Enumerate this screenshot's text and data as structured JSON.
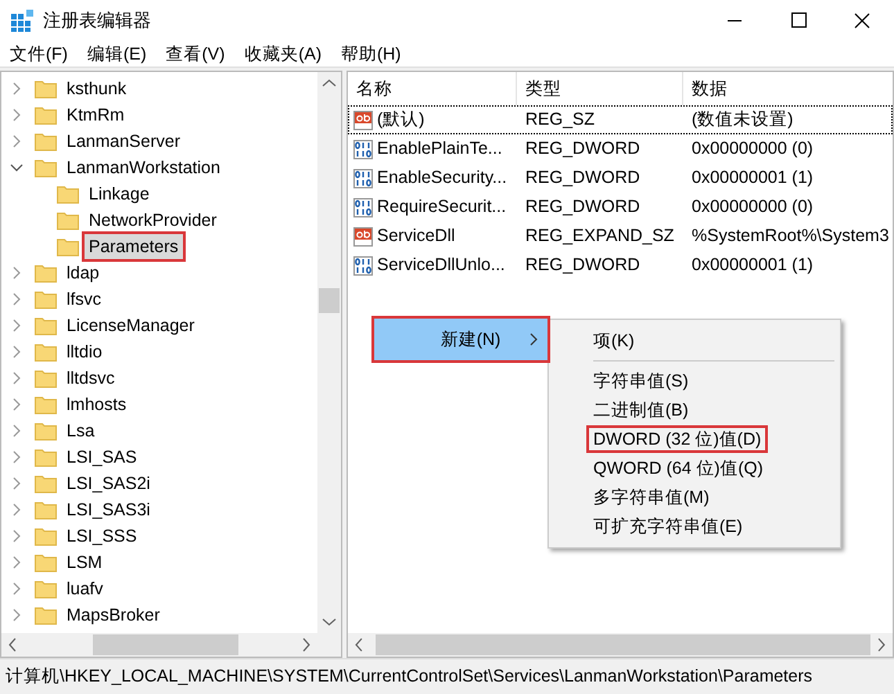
{
  "window": {
    "title": "注册表编辑器"
  },
  "menu": [
    "文件(F)",
    "编辑(E)",
    "查看(V)",
    "收藏夹(A)",
    "帮助(H)"
  ],
  "tree": {
    "items": [
      {
        "label": "ksthunk",
        "expanded": false,
        "selected": false
      },
      {
        "label": "KtmRm",
        "expanded": false,
        "selected": false
      },
      {
        "label": "LanmanServer",
        "expanded": false,
        "selected": false
      },
      {
        "label": "LanmanWorkstation",
        "expanded": true,
        "selected": false,
        "children": [
          {
            "label": "Linkage",
            "selected": false
          },
          {
            "label": "NetworkProvider",
            "selected": false
          },
          {
            "label": "Parameters",
            "selected": true,
            "annotated": true
          }
        ]
      },
      {
        "label": "ldap",
        "expanded": false,
        "selected": false
      },
      {
        "label": "lfsvc",
        "expanded": false,
        "selected": false
      },
      {
        "label": "LicenseManager",
        "expanded": false,
        "selected": false
      },
      {
        "label": "lltdio",
        "expanded": false,
        "selected": false
      },
      {
        "label": "lltdsvc",
        "expanded": false,
        "selected": false
      },
      {
        "label": "lmhosts",
        "expanded": false,
        "selected": false
      },
      {
        "label": "Lsa",
        "expanded": false,
        "selected": false
      },
      {
        "label": "LSI_SAS",
        "expanded": false,
        "selected": false
      },
      {
        "label": "LSI_SAS2i",
        "expanded": false,
        "selected": false
      },
      {
        "label": "LSI_SAS3i",
        "expanded": false,
        "selected": false
      },
      {
        "label": "LSI_SSS",
        "expanded": false,
        "selected": false
      },
      {
        "label": "LSM",
        "expanded": false,
        "selected": false
      },
      {
        "label": "luafv",
        "expanded": false,
        "selected": false
      },
      {
        "label": "MapsBroker",
        "expanded": false,
        "selected": false
      }
    ]
  },
  "values": {
    "columns": [
      "名称",
      "类型",
      "数据"
    ],
    "rows": [
      {
        "kind": "string",
        "name": "(默认)",
        "type": "REG_SZ",
        "data": "(数值未设置)",
        "focused": true
      },
      {
        "kind": "binary",
        "name": "EnablePlainTe...",
        "type": "REG_DWORD",
        "data": "0x00000000 (0)",
        "focused": false
      },
      {
        "kind": "binary",
        "name": "EnableSecurity...",
        "type": "REG_DWORD",
        "data": "0x00000001 (1)",
        "focused": false
      },
      {
        "kind": "binary",
        "name": "RequireSecurit...",
        "type": "REG_DWORD",
        "data": "0x00000000 (0)",
        "focused": false
      },
      {
        "kind": "string",
        "name": "ServiceDll",
        "type": "REG_EXPAND_SZ",
        "data": "%SystemRoot%\\System3",
        "focused": false
      },
      {
        "kind": "binary",
        "name": "ServiceDllUnlo...",
        "type": "REG_DWORD",
        "data": "0x00000001 (1)",
        "focused": false
      }
    ]
  },
  "context_menu": {
    "items": [
      {
        "label": "新建(N)",
        "selected": true,
        "annotated": true,
        "has_submenu": true
      }
    ]
  },
  "submenu": {
    "items": [
      {
        "kind": "item",
        "label": "项(K)",
        "annotated": false
      },
      {
        "kind": "separator"
      },
      {
        "kind": "item",
        "label": "字符串值(S)",
        "annotated": false
      },
      {
        "kind": "item",
        "label": "二进制值(B)",
        "annotated": false
      },
      {
        "kind": "item",
        "label": "DWORD (32 位)值(D)",
        "annotated": true
      },
      {
        "kind": "item",
        "label": "QWORD (64 位)值(Q)",
        "annotated": false
      },
      {
        "kind": "item",
        "label": "多字符串值(M)",
        "annotated": false
      },
      {
        "kind": "item",
        "label": "可扩充字符串值(E)",
        "annotated": false
      }
    ]
  },
  "status_bar": "计算机\\HKEY_LOCAL_MACHINE\\SYSTEM\\CurrentControlSet\\Services\\LanmanWorkstation\\Parameters"
}
